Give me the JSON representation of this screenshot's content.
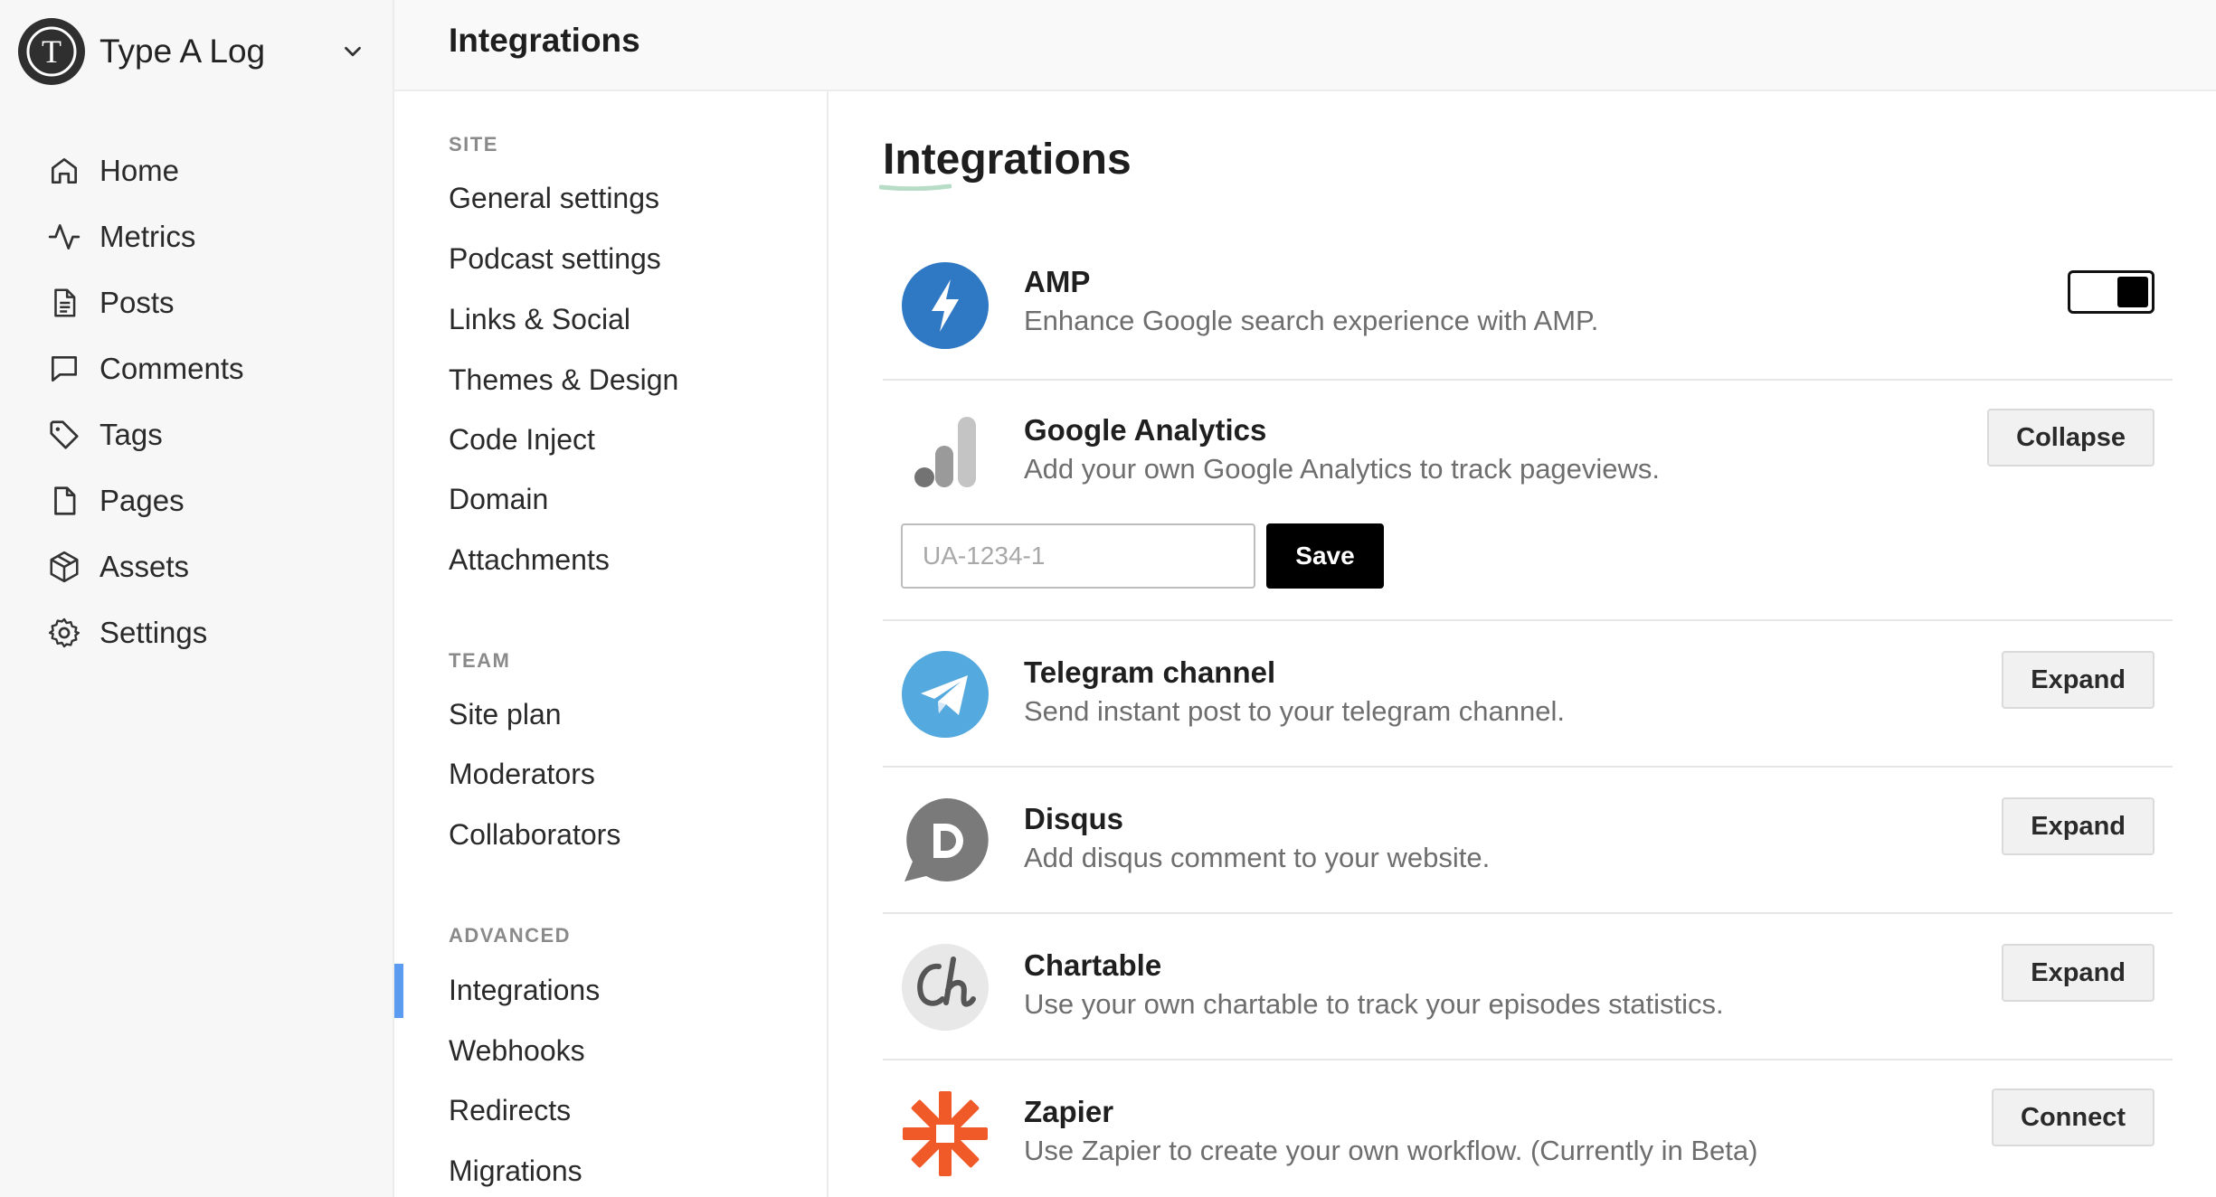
{
  "brand": {
    "name": "Type A Log",
    "logo_letter": "T"
  },
  "sidebar": {
    "items": [
      {
        "label": "Home",
        "icon": "home-icon"
      },
      {
        "label": "Metrics",
        "icon": "activity-icon"
      },
      {
        "label": "Posts",
        "icon": "document-icon"
      },
      {
        "label": "Comments",
        "icon": "comment-icon"
      },
      {
        "label": "Tags",
        "icon": "tag-icon"
      },
      {
        "label": "Pages",
        "icon": "page-icon"
      },
      {
        "label": "Assets",
        "icon": "box-icon"
      },
      {
        "label": "Settings",
        "icon": "gear-icon"
      }
    ]
  },
  "topbar": {
    "title": "Integrations"
  },
  "subnav": {
    "sections": [
      {
        "title": "SITE",
        "items": [
          "General settings",
          "Podcast settings",
          "Links & Social",
          "Themes & Design",
          "Code Inject",
          "Domain",
          "Attachments"
        ]
      },
      {
        "title": "TEAM",
        "items": [
          "Site plan",
          "Moderators",
          "Collaborators"
        ]
      },
      {
        "title": "ADVANCED",
        "items": [
          "Integrations",
          "Webhooks",
          "Redirects",
          "Migrations"
        ]
      }
    ],
    "active": "Integrations"
  },
  "main": {
    "title": "Integrations",
    "integrations": [
      {
        "name": "AMP",
        "description": "Enhance Google search experience with AMP.",
        "icon": "amp-lightning-icon",
        "color": "#2f78c4",
        "control": "toggle",
        "enabled": true
      },
      {
        "name": "Google Analytics",
        "description": "Add your own Google Analytics to track pageviews.",
        "icon": "analytics-bars-icon",
        "action": "Collapse",
        "input_placeholder": "UA-1234-1",
        "save_label": "Save"
      },
      {
        "name": "Telegram channel",
        "description": "Send instant post to your telegram channel.",
        "icon": "telegram-icon",
        "color": "#54a9de",
        "action": "Expand"
      },
      {
        "name": "Disqus",
        "description": "Add disqus comment to your website.",
        "icon": "disqus-icon",
        "color": "#7a7a7a",
        "action": "Expand"
      },
      {
        "name": "Chartable",
        "description": "Use your own chartable to track your episodes statistics.",
        "icon": "chartable-icon",
        "action": "Expand"
      },
      {
        "name": "Zapier",
        "description": "Use Zapier to create your own workflow. (Currently in Beta)",
        "icon": "zapier-icon",
        "color": "#f05a28",
        "action": "Connect"
      }
    ]
  },
  "colors": {
    "accent": "#5b9cf0",
    "underline": "#b8ddc6"
  }
}
